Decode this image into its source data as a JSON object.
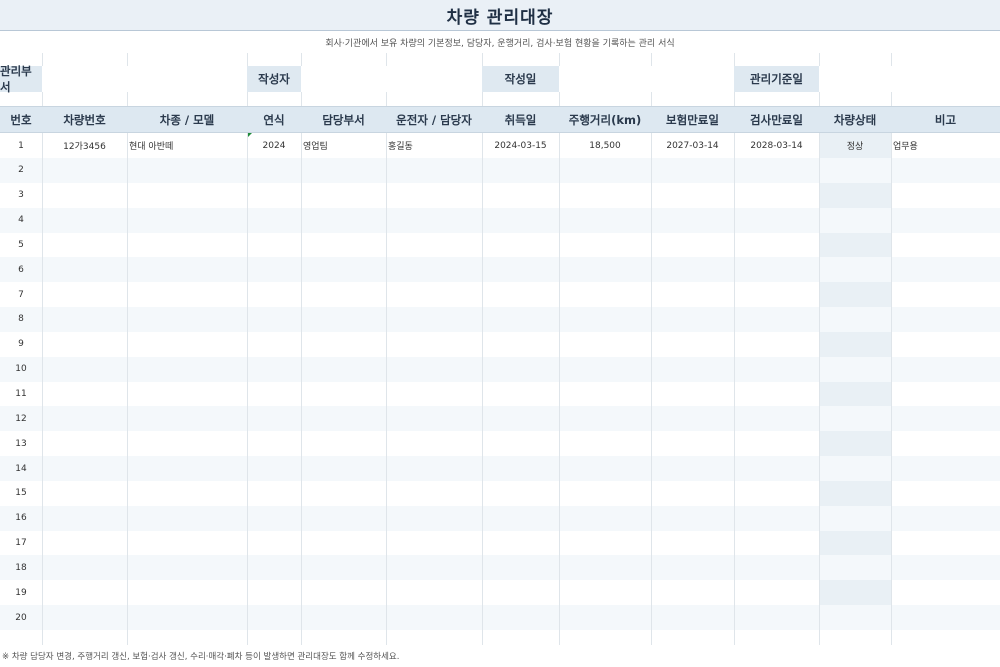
{
  "title": "차량 관리대장",
  "subtitle": "회사·기관에서 보유 차량의 기본정보, 담당자, 운행거리, 검사·보험 현황을 기록하는 관리 서식",
  "meta": {
    "dept_label": "관리부서",
    "writer_label": "작성자",
    "date_label": "작성일",
    "base_date_label": "관리기준일"
  },
  "columns": [
    "번호",
    "차량번호",
    "차종 / 모델",
    "연식",
    "담당부서",
    "운전자 / 담당자",
    "취득일",
    "주행거리(km)",
    "보험만료일",
    "검사만료일",
    "차량상태",
    "비고"
  ],
  "rows": [
    {
      "no": "1",
      "plate": "12가3456",
      "model": "현대 아반떼",
      "year": "2024",
      "dept": "영업팀",
      "driver": "홍길동",
      "acquired": "2024-03-15",
      "mileage": "18,500",
      "insurance": "2027-03-14",
      "inspection": "2028-03-14",
      "status": "정상",
      "note": "업무용"
    },
    {
      "no": "2"
    },
    {
      "no": "3"
    },
    {
      "no": "4"
    },
    {
      "no": "5"
    },
    {
      "no": "6"
    },
    {
      "no": "7"
    },
    {
      "no": "8"
    },
    {
      "no": "9"
    },
    {
      "no": "10"
    },
    {
      "no": "11"
    },
    {
      "no": "12"
    },
    {
      "no": "13"
    },
    {
      "no": "14"
    },
    {
      "no": "15"
    },
    {
      "no": "16"
    },
    {
      "no": "17"
    },
    {
      "no": "18"
    },
    {
      "no": "19"
    },
    {
      "no": "20"
    }
  ],
  "footnote": "※ 차량 담당자 변경, 주행거리 갱신, 보험·검사 갱신, 수리·매각·폐차 등이 발생하면 관리대장도 함께 수정하세요."
}
